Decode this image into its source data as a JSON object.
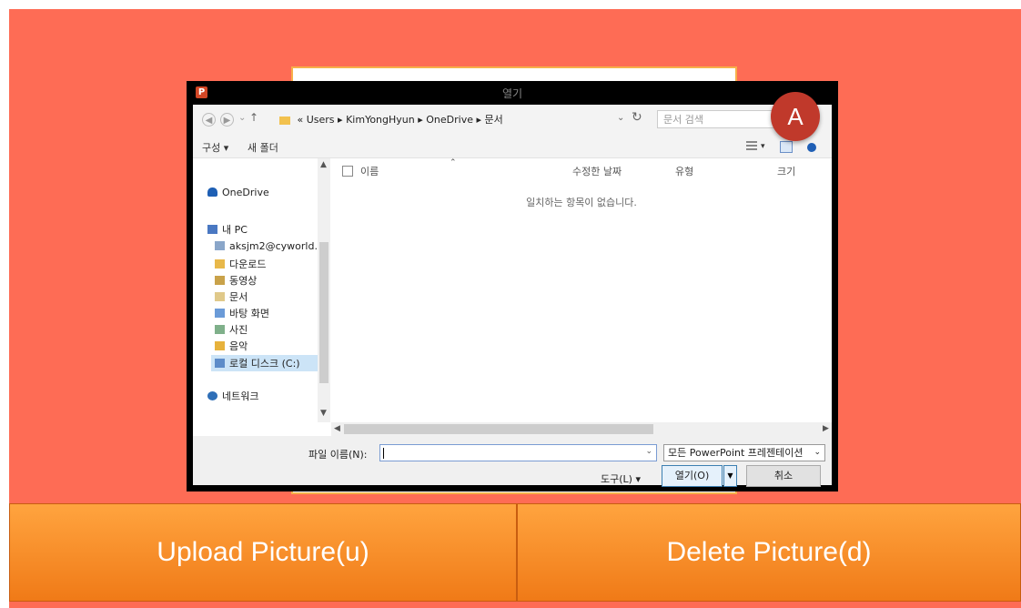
{
  "dialog": {
    "title": "열기",
    "app_icon_letter": "P",
    "address": {
      "prefix": "«",
      "path": [
        "Users",
        "KimYongHyun",
        "OneDrive",
        "문서"
      ],
      "separator": "▸"
    },
    "search_placeholder": "문서 검색",
    "toolbar": {
      "organize": "구성 ▾",
      "new_folder": "새 폴더"
    },
    "nav": {
      "onedrive": "OneDrive",
      "this_pc": "내 PC",
      "items": [
        "aksjm2@cyworld.",
        "다운로드",
        "동영상",
        "문서",
        "바탕 화면",
        "사진",
        "음악",
        "로컬 디스크 (C:)"
      ],
      "network": "네트워크"
    },
    "columns": {
      "name": "이름",
      "date": "수정한 날짜",
      "type": "유형",
      "size": "크기"
    },
    "empty_message": "일치하는 항목이 없습니다.",
    "filename_label": "파일 이름(N):",
    "filename_value": "",
    "file_type": "모든 PowerPoint 프레젠테이션",
    "tools": "도구(L)  ▾",
    "open": "열기(O)",
    "cancel": "취소"
  },
  "badge": "A",
  "buttons": {
    "upload": "Upload Picture(u)",
    "delete": "Delete Picture(d)"
  },
  "colors": {
    "background": "#fe6c55",
    "button": "#f88c2c",
    "badge": "#c0392b",
    "paper_border": "#f7b04a"
  }
}
